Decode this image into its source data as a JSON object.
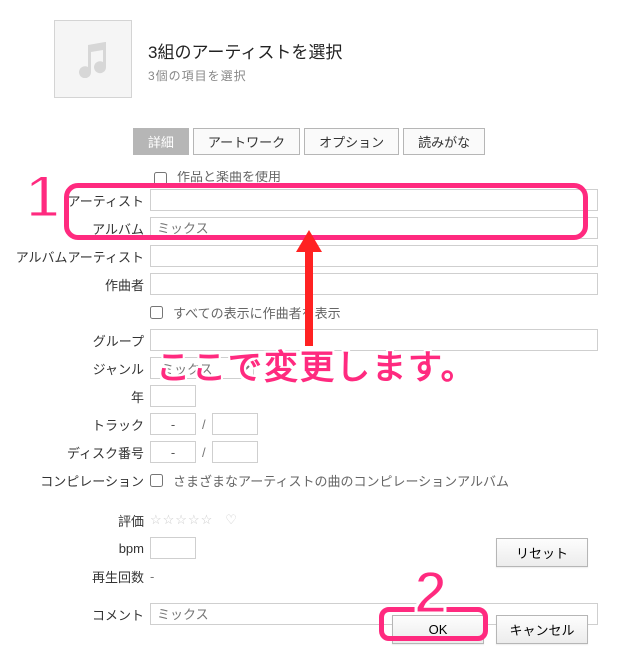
{
  "header": {
    "title": "3組のアーティストを選択",
    "subtitle": "3個の項目を選択"
  },
  "tabs": {
    "details": "詳細",
    "artwork": "アートワーク",
    "options": "オプション",
    "sorting": "読みがな"
  },
  "form": {
    "topcut_label": "作品と楽曲を使用",
    "artist_label": "アーティスト",
    "artist_value": "",
    "album_label": "アルバム",
    "album_value": "",
    "album_placeholder": "ミックス",
    "albumartist_label": "アルバムアーティスト",
    "albumartist_value": "",
    "composer_label": "作曲者",
    "composer_value": "",
    "show_composer_label": "すべての表示に作曲者を表示",
    "group_label": "グループ",
    "group_value": "",
    "genre_label": "ジャンル",
    "genre_selected": "ミックス",
    "year_label": "年",
    "year_value": "",
    "track_label": "トラック",
    "track_cur": "-",
    "track_sep": "/",
    "track_tot": "",
    "disc_label": "ディスク番号",
    "disc_cur": "-",
    "disc_sep": "/",
    "disc_tot": "",
    "compilation_label": "コンピレーション",
    "compilation_text": "さまざまなアーティストの曲のコンピレーションアルバム",
    "rating_label": "評価",
    "rating_stars": "☆☆☆☆☆",
    "rating_heart": "♡",
    "bpm_label": "bpm",
    "bpm_value": "",
    "playcount_label": "再生回数",
    "playcount_value": "-",
    "comment_label": "コメント",
    "comment_value": "",
    "comment_placeholder": "ミックス"
  },
  "buttons": {
    "reset": "リセット",
    "ok": "OK",
    "cancel": "キャンセル"
  },
  "annotations": {
    "badge1": "1",
    "badge2": "2",
    "note": "ここで変更します。"
  }
}
